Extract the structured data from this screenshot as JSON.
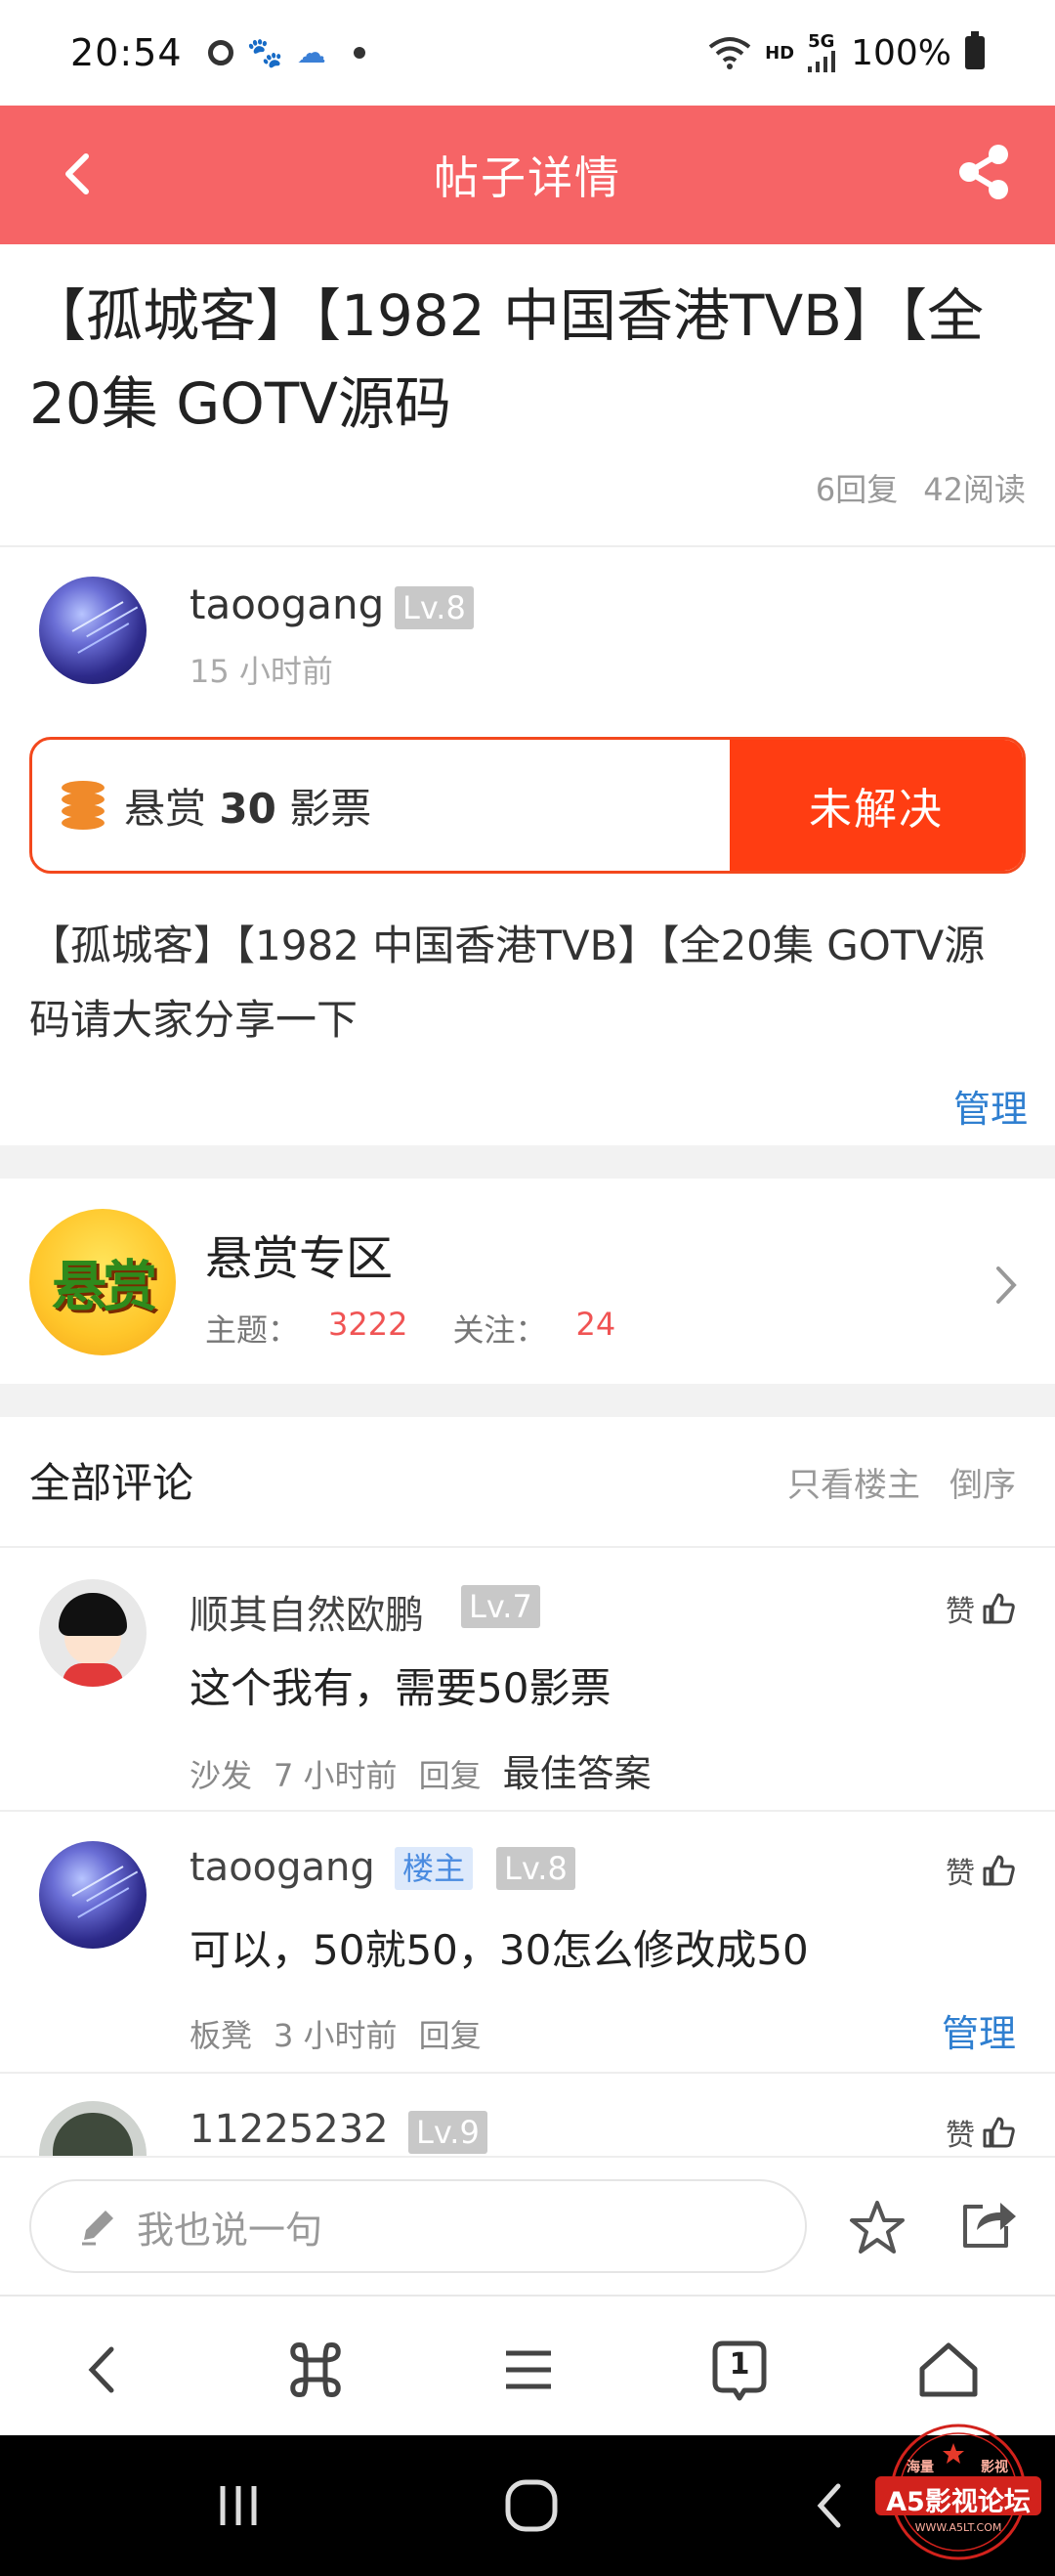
{
  "status_bar": {
    "time": "20:54",
    "battery": "100%",
    "hd": "HD",
    "network": "5G"
  },
  "header": {
    "title": "帖子详情"
  },
  "post": {
    "title": "【孤城客】【1982 中国香港TVB】【全20集 GOTV源码",
    "replies": "6回复",
    "reads": "42阅读",
    "author": {
      "name": "taoogang",
      "level": "Lv.8",
      "time": "15 小时前"
    },
    "bounty": {
      "prefix": "悬赏",
      "amount": "30",
      "unit": "影票",
      "status": "未解决"
    },
    "body": "【孤城客】【1982 中国香港TVB】【全20集 GOTV源码请大家分享一下",
    "manage_label": "管理"
  },
  "forum": {
    "logo_text": "悬赏",
    "name": "悬赏专区",
    "topics_label": "主题：",
    "topics": "3222",
    "follows_label": "关注：",
    "follows": "24"
  },
  "comments": {
    "title": "全部评论",
    "only_host": "只看楼主",
    "reverse": "倒序",
    "like_label": "赞",
    "reply_label": "回复",
    "items": [
      {
        "name": "顺其自然欧鹏",
        "level": "Lv.7",
        "text": "这个我有，需要50影票",
        "floor": "沙发",
        "time": "7 小时前",
        "extra": "最佳答案"
      },
      {
        "name": "taoogang",
        "badge": "楼主",
        "level": "Lv.8",
        "text": "可以，50就50，30怎么修改成50",
        "floor": "板凳",
        "time": "3 小时前",
        "manage": "管理"
      },
      {
        "name": "11225232",
        "level": "Lv.9"
      }
    ]
  },
  "input_bar": {
    "placeholder": "我也说一句"
  },
  "browser_nav": {
    "tab_count": "1"
  },
  "watermark": {
    "top_left": "海量",
    "top_right": "影视",
    "main": "A5影视论坛",
    "url": "WWW.A5LT.COM"
  },
  "colors": {
    "header": "#f66466",
    "bounty_accent": "#ff3d12",
    "link": "#2f7fd0",
    "count": "#f05454"
  }
}
